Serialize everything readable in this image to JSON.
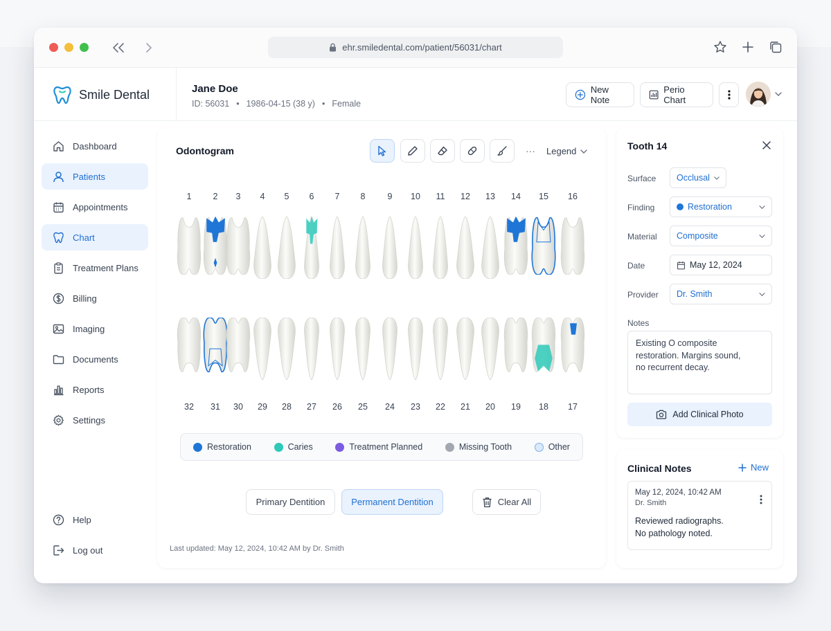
{
  "browser": {
    "url": "ehr.smiledental.com/patient/56031/chart",
    "icons": [
      "back-icon",
      "forward-icon",
      "lock-icon",
      "star-icon",
      "plus-icon",
      "tabs-icon"
    ]
  },
  "brand": {
    "name": "Smile Dental",
    "color": "#1f8fd6"
  },
  "patient": {
    "name": "Jane Doe",
    "id": "ID: 56031",
    "dob": "1986-04-15 (38 y)",
    "sex": "Female"
  },
  "header_actions": {
    "new_note": "New Note",
    "perio_chart": "Perio Chart"
  },
  "sidebar": {
    "items": [
      {
        "label": "Dashboard",
        "icon": "home-icon",
        "active": false
      },
      {
        "label": "Patients",
        "icon": "user-icon",
        "active": true
      },
      {
        "label": "Appointments",
        "icon": "calendar-icon",
        "active": false
      },
      {
        "label": "Chart",
        "icon": "tooth-icon",
        "active": true
      },
      {
        "label": "Treatment Plans",
        "icon": "clipboard-icon",
        "active": false
      },
      {
        "label": "Billing",
        "icon": "dollar-icon",
        "active": false
      },
      {
        "label": "Imaging",
        "icon": "image-icon",
        "active": false
      },
      {
        "label": "Documents",
        "icon": "folder-icon",
        "active": false
      },
      {
        "label": "Reports",
        "icon": "bar-chart-icon",
        "active": false
      },
      {
        "label": "Settings",
        "icon": "gear-icon",
        "active": false
      }
    ],
    "help": "Help",
    "logout": "Log out"
  },
  "odontogram": {
    "title": "Odontogram",
    "tools": [
      "select-tool-icon",
      "pencil-tool-icon",
      "eraser-tool-icon",
      "bandage-tool-icon",
      "brush-tool-icon"
    ],
    "more": "···",
    "legend_toggle": "Legend",
    "upper_numbers": [
      "1",
      "2",
      "3",
      "4",
      "5",
      "6",
      "7",
      "8",
      "9",
      "10",
      "11",
      "12",
      "13",
      "14",
      "15",
      "16"
    ],
    "lower_numbers": [
      "32",
      "31",
      "30",
      "29",
      "28",
      "27",
      "26",
      "25",
      "24",
      "23",
      "22",
      "21",
      "20",
      "19",
      "18",
      "17"
    ],
    "findings": {
      "2": "restoration",
      "6": "caries",
      "14": "restoration",
      "15": "selected",
      "31": "selected",
      "18": "caries",
      "17": "restoration"
    },
    "legend": [
      {
        "label": "Restoration",
        "color": "#1f76d6"
      },
      {
        "label": "Caries",
        "color": "#2ec9b8"
      },
      {
        "label": "Treatment Planned",
        "color": "#7c5ce0"
      },
      {
        "label": "Missing Tooth",
        "color": "#a3a8b0"
      },
      {
        "label": "Other",
        "color": "#dbe9f9"
      }
    ],
    "primary_btn": "Primary Dentition",
    "permanent_btn": "Permanent Dentition",
    "clear_btn": "Clear All",
    "last_updated": "Last updated: May 12, 2024, 10:42 AM by Dr. Smith"
  },
  "tooth_panel": {
    "title": "Tooth 14",
    "surface_label": "Surface",
    "surface": "Occlusal",
    "finding_label": "Finding",
    "finding": "Restoration",
    "material_label": "Material",
    "material": "Composite",
    "date_label": "Date",
    "date": "May 12, 2024",
    "provider_label": "Provider",
    "provider": "Dr. Smith",
    "notes_label": "Notes",
    "notes": "Existing O composite\nrestoration. Margins sound,\nno recurrent decay.",
    "add_photo": "Add Clinical Photo"
  },
  "clinical_notes": {
    "title": "Clinical Notes",
    "new": "New",
    "entry": {
      "timestamp": "May 12, 2024, 10:42 AM",
      "author": "Dr. Smith",
      "text": "Reviewed radiographs.\nNo pathology noted."
    }
  }
}
